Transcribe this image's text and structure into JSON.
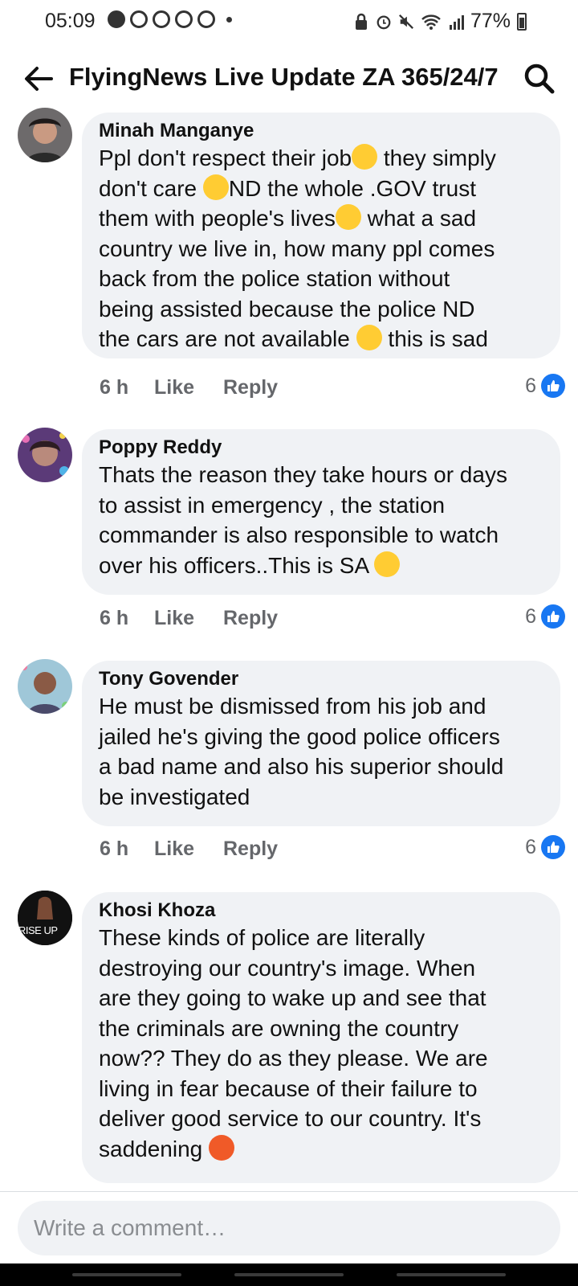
{
  "status_bar": {
    "time": "05:09",
    "battery": "77%"
  },
  "header": {
    "title": "FlyingNews Live Update ZA 365/24/7"
  },
  "comments": [
    {
      "author": "Minah Manganye",
      "lines": [
        "Ppl don't respect their job",
        " they simply",
        "don't care ",
        "ND the whole .GOV trust",
        "them with people's lives",
        " what a sad",
        "country we live in, how many ppl comes",
        "back from the police station without",
        "being assisted because the police ND",
        "the cars are not available ",
        " this is sad"
      ],
      "time": "6 h",
      "like": "Like",
      "reply": "Reply",
      "reactions": "6"
    },
    {
      "author": "Poppy Reddy",
      "lines": [
        "Thats the reason they take hours or days",
        "to assist in emergency , the station",
        "commander is also responsible to watch",
        "over his officers..This is SA "
      ],
      "time": "6 h",
      "like": "Like",
      "reply": "Reply",
      "reactions": "6"
    },
    {
      "author": "Tony Govender",
      "lines": [
        "He must be dismissed from his job and",
        "jailed he's giving the good police officers",
        "a bad name and also his superior should",
        "be investigated"
      ],
      "time": "6 h",
      "like": "Like",
      "reply": "Reply",
      "reactions": "6"
    },
    {
      "author": "Khosi Khoza",
      "avatar_text": "RISE UP",
      "lines": [
        "These kinds of police are literally",
        "destroying our country's image. When",
        "are they going to wake up and see that",
        "the criminals are owning the country",
        "now?? They do as they please. We are",
        "living in fear because of their failure to",
        "deliver good service to our country. It's",
        "saddening "
      ]
    }
  ],
  "composer": {
    "placeholder": "Write a comment…"
  },
  "colors": {
    "like_blue": "#1877f2",
    "bubble_gray": "#f0f2f5"
  }
}
